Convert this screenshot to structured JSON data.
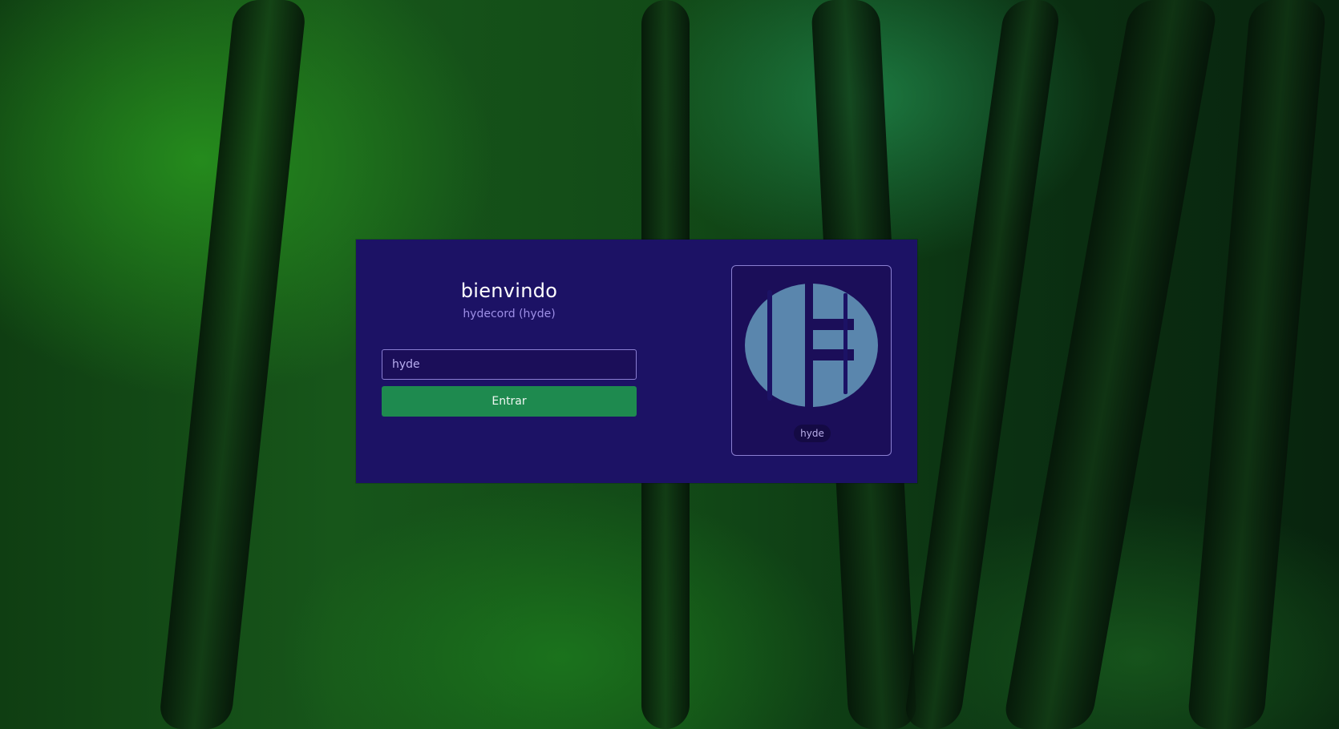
{
  "login": {
    "title": "bienvindo",
    "subtitle": "hydecord (hyde)",
    "input_value": "hyde",
    "enter_label": "Entrar"
  },
  "user_tile": {
    "avatar_icon": "hyde-h-logo-icon",
    "username": "hyde"
  },
  "colors": {
    "card_background": "#1c1265",
    "input_background": "#1b0e59",
    "button_green": "#1e8a4f",
    "avatar_blue": "#5a86ad",
    "subtitle_purple": "#9d8fe6"
  }
}
